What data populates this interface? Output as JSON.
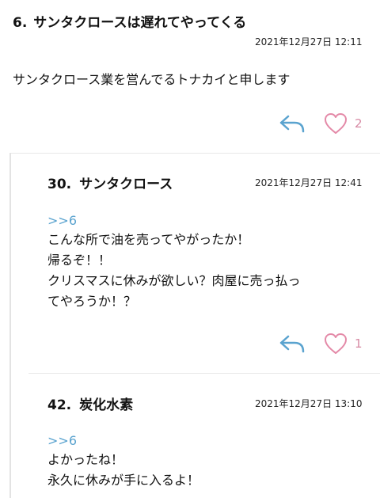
{
  "post": {
    "number": "6.",
    "title": "サンタクロースは遅れてやってくる",
    "date": "2021年12月27日 12:11",
    "body": "サンタクロース業を営んでるトナカイと申します",
    "likes": "2"
  },
  "replies": [
    {
      "number": "30.",
      "name": "サンタクロース",
      "date": "2021年12月27日 12:41",
      "anchor": ">>6",
      "body": "こんな所で油を売ってやがったか！\n帰るぞ！！\nクリスマスに休みが欲しい？肉屋に売っ払っ\nてやろうか！？",
      "likes": "1"
    },
    {
      "number": "42.",
      "name": "炭化水素",
      "date": "2021年12月27日 13:10",
      "anchor": ">>6",
      "body": "よかったね！\n永久に休みが手に入るよ！"
    }
  ],
  "colors": {
    "reply_icon": "#5aa3cf",
    "heart_icon": "#e48aa8",
    "anchor": "#5aa3cf"
  },
  "icons": {
    "reply": "reply-arrow-icon",
    "like": "heart-outline-icon"
  }
}
